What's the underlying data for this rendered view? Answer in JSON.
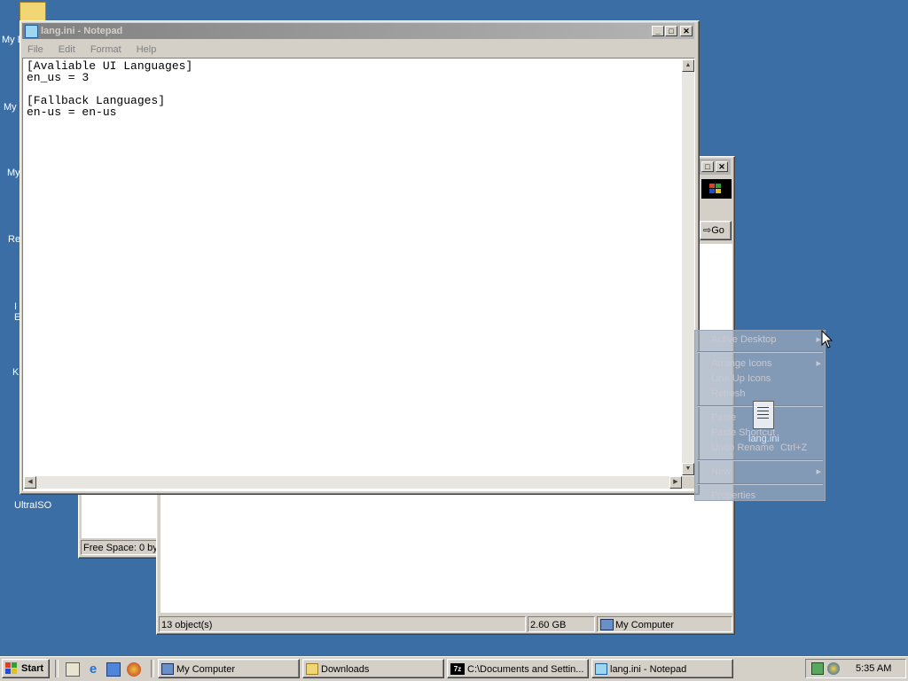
{
  "desktop": {
    "icons": [
      {
        "label": "My D"
      },
      {
        "label": "My"
      },
      {
        "label": "My"
      },
      {
        "label": "Re"
      },
      {
        "label": "I"
      },
      {
        "label": "E"
      },
      {
        "label": "K"
      },
      {
        "label": "UltraISO"
      }
    ]
  },
  "notepad": {
    "title": "lang.ini - Notepad",
    "menu": [
      "File",
      "Edit",
      "Format",
      "Help"
    ],
    "content": "[Avaliable UI Languages]\nen_us = 3\n\n[Fallback Languages]\nen-us = en-us"
  },
  "explorer": {
    "go_label": "Go",
    "status": {
      "objects": "13 object(s)",
      "size": "2.60 GB",
      "zone": "My Computer"
    },
    "left_pane_status": "Free Space: 0 by"
  },
  "context_menu": {
    "items": [
      {
        "label": "Active Desktop",
        "shortcut": "",
        "submenu": true
      },
      {
        "label": "Arrange Icons",
        "shortcut": "",
        "submenu": true
      },
      {
        "label": "Line Up Icons",
        "shortcut": "",
        "submenu": false
      },
      {
        "label": "Refresh",
        "shortcut": "",
        "submenu": false
      },
      {
        "label": "Paste",
        "shortcut": "",
        "submenu": false
      },
      {
        "label": "Paste Shortcut",
        "shortcut": "",
        "submenu": false
      },
      {
        "label": "Undo Rename",
        "shortcut": "Ctrl+Z",
        "submenu": false
      },
      {
        "label": "New",
        "shortcut": "",
        "submenu": true
      },
      {
        "label": "Properties",
        "shortcut": "",
        "submenu": false
      }
    ]
  },
  "dragged_file": {
    "label": "lang.ini"
  },
  "taskbar": {
    "start_label": "Start",
    "tasks": [
      {
        "label": "My Computer"
      },
      {
        "label": "Downloads"
      },
      {
        "label": "C:\\Documents and Settin..."
      },
      {
        "label": "lang.ini - Notepad"
      }
    ],
    "clock": "5:35 AM"
  }
}
